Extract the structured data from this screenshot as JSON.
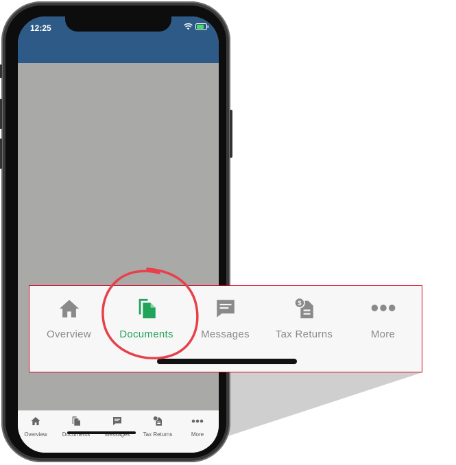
{
  "status_bar": {
    "time": "12:25"
  },
  "tabs": [
    {
      "label": "Overview",
      "icon": "home-icon",
      "active": false
    },
    {
      "label": "Documents",
      "icon": "documents-icon",
      "active": true
    },
    {
      "label": "Messages",
      "icon": "messages-icon",
      "active": false
    },
    {
      "label": "Tax Returns",
      "icon": "tax-returns-icon",
      "active": false
    },
    {
      "label": "More",
      "icon": "more-icon",
      "active": false
    }
  ],
  "colors": {
    "header": "#2e5a87",
    "active_tab": "#22a35a",
    "inactive_tab": "#8a8a8a",
    "highlight_circle": "#e8404a",
    "callout_border": "#d0021b"
  }
}
